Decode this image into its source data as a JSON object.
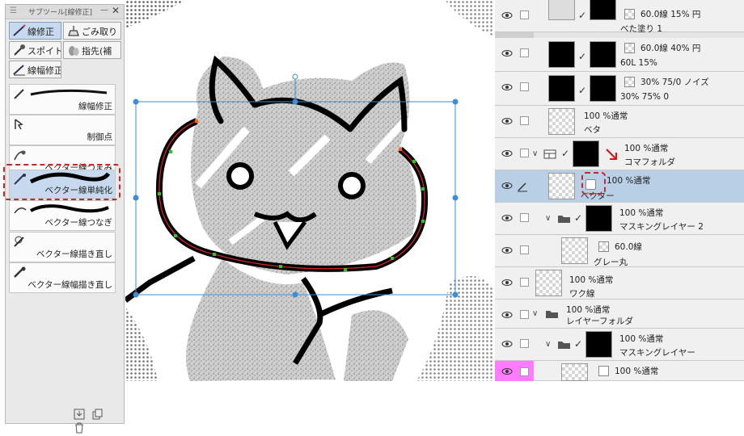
{
  "subtool": {
    "title": "サブツール[線修正]",
    "groups": [
      {
        "label": "線修正",
        "icon": "line-correction-icon",
        "selected": true
      },
      {
        "label": "ごみ取り",
        "icon": "dust-removal-icon",
        "selected": false
      },
      {
        "label": "スポイト",
        "icon": "eyedropper-icon",
        "selected": false
      },
      {
        "label": "指先(補",
        "icon": "finger-blend-icon",
        "selected": false
      },
      {
        "label": "線幅修正",
        "icon": "line-width-icon",
        "selected": false
      }
    ],
    "tools": [
      {
        "label": "線幅修正",
        "selected": false
      },
      {
        "label": "制御点",
        "selected": false
      },
      {
        "label": "ベクター線つまみ",
        "selected": false
      },
      {
        "label": "ベクター線単純化",
        "selected": true
      },
      {
        "label": "ベクター線つなぎ",
        "selected": false
      },
      {
        "label": "ベクター線描き直し",
        "selected": false
      },
      {
        "label": "ベクター線幅描き直し",
        "selected": false
      }
    ],
    "highlight_color": "#c2292b"
  },
  "layers": {
    "rows": [
      {
        "line1": "60.0線 15% 円",
        "line2": "べた塗り 1"
      },
      {
        "line1": "60.0線 40% 円",
        "line2": "60L 15%"
      },
      {
        "line1": "30% 75/0 ノイズ",
        "line2": "30% 75% 0"
      },
      {
        "line1": "100 %通常",
        "line2": "ベタ"
      },
      {
        "line1": "100 %通常",
        "line2": "コマフォルダ"
      },
      {
        "line1": "100 %通常",
        "line2": "ベクター"
      },
      {
        "line1": "100 %通常",
        "line2": "マスキングレイヤー 2"
      },
      {
        "line1": "60.0線",
        "line2": "グレー丸"
      },
      {
        "line1": "100 %通常",
        "line2": "ワク線"
      },
      {
        "line1": "100 %通常",
        "line2": "レイヤーフォルダ"
      },
      {
        "line1": "100 %通常",
        "line2": "マスキングレイヤー"
      },
      {
        "line1": "100 %通常",
        "line2": ""
      }
    ],
    "selected_index": 5,
    "accent_color": "#b9cfe6",
    "color_tag": "#ff7bff"
  }
}
